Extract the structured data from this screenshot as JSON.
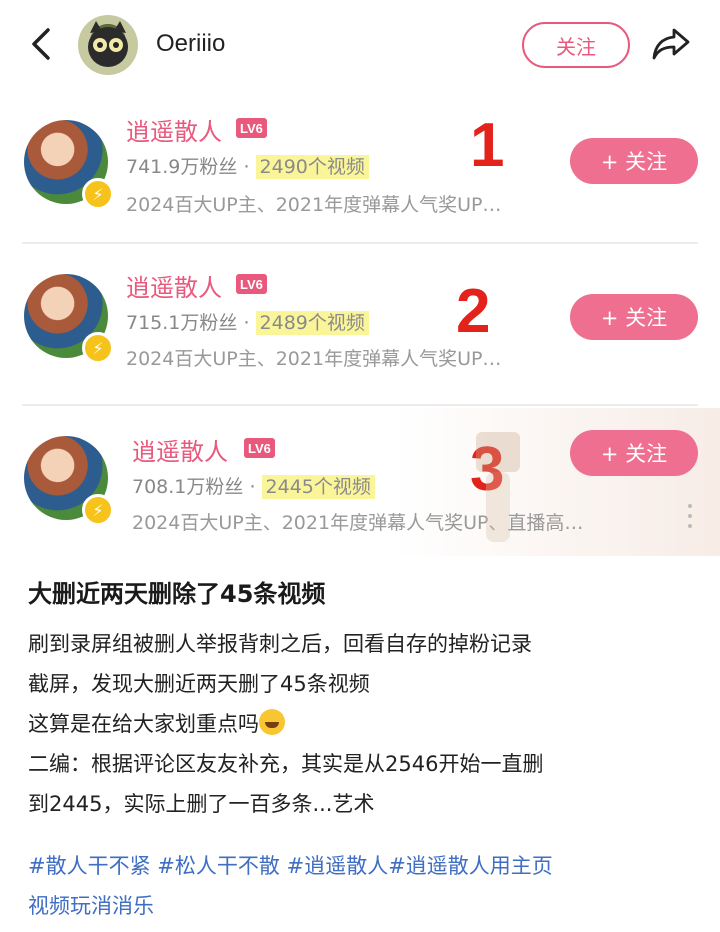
{
  "header": {
    "username": "Oeriiio",
    "follow_label": "关注"
  },
  "cards": [
    {
      "name": "逍遥散人",
      "level": "LV6",
      "fans": "741.9万粉丝",
      "separator": "·",
      "videos": "2490个视频",
      "desc": "2024百大UP主、2021年度弹幕人气奖UP…",
      "marker": "1",
      "follow_label": "+ 关注"
    },
    {
      "name": "逍遥散人",
      "level": "LV6",
      "fans": "715.1万粉丝",
      "separator": "·",
      "videos": "2489个视频",
      "desc": "2024百大UP主、2021年度弹幕人气奖UP…",
      "marker": "2",
      "follow_label": "+ 关注"
    },
    {
      "name": "逍遥散人",
      "level": "LV6",
      "fans": "708.1万粉丝",
      "separator": "·",
      "videos": "2445个视频",
      "desc": "2024百大UP主、2021年度弹幕人气奖UP、直播高…",
      "marker": "3",
      "follow_label": "+ 关注"
    }
  ],
  "post": {
    "title": "大删近两天删除了45条视频",
    "lines": [
      "刷到录屏组被删人举报背刺之后，回看自存的掉粉记录",
      "截屏，发现大删近两天删了45条视频",
      "这算是在给大家划重点吗",
      "二编：根据评论区友友补充，其实是从2546开始一直删",
      "到2445，实际上删了一百多条...艺术"
    ],
    "tags": [
      "#散人干不紧",
      "#松人干不散",
      "#逍遥散人",
      "#逍遥散人用主页视频玩消消乐"
    ],
    "tag_line2": "视频玩消消乐",
    "tag_last_part1": "#逍遥散人用主页"
  },
  "colors": {
    "accent": "#e9597d",
    "button_fill": "#ee6f8f",
    "marker": "#e3231b",
    "highlight": "#fbf59a",
    "tag": "#3f6ec2"
  }
}
